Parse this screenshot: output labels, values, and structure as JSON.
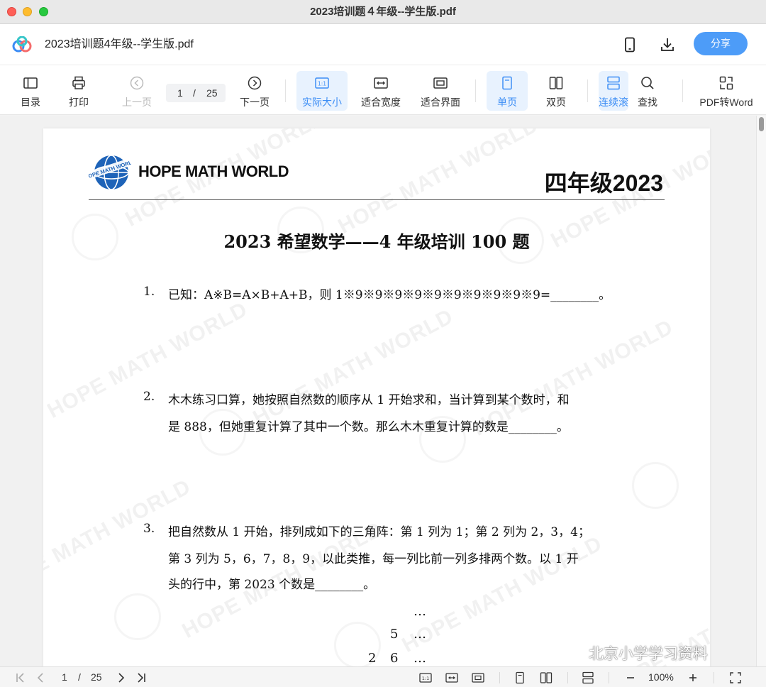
{
  "window": {
    "title": "2023培训题４年级--学生版.pdf"
  },
  "app": {
    "doc_title": "2023培训题4年级--学生版.pdf",
    "share_label": "分享"
  },
  "toolbar": {
    "toc": "目录",
    "print": "打印",
    "prev": "上一页",
    "page_current": "1",
    "page_sep": "/",
    "page_total": "25",
    "next": "下一页",
    "actual_size": "实际大小",
    "fit_width": "适合宽度",
    "fit_page": "适合界面",
    "single": "单页",
    "double": "双页",
    "continuous": "连续滚",
    "search": "查找",
    "pdf_to_word": "PDF转Word"
  },
  "document": {
    "brand": "HOPE MATH WORLD",
    "globe_text": "HOPE MATH WORLD",
    "grade": "四年级2023",
    "heading": "2023 希望数学——4 年级培训 100 题",
    "watermark_text": "HOPE MATH WORLD",
    "questions": [
      {
        "num": "1.",
        "lines": [
          "已知：A※B=A×B+A+B，则 1※9※9※9※9※9※9※9※9※9※9=________。"
        ]
      },
      {
        "num": "2.",
        "lines": [
          "木木练习口算，她按照自然数的顺序从 1 开始求和，当计算到某个数时，和",
          "是 888，但她重复计算了其中一个数。那么木木重复计算的数是________。"
        ]
      },
      {
        "num": "3.",
        "lines": [
          "把自然数从 1 开始，排列成如下的三角阵：第 1 列为 1；第 2 列为 2，3，4；",
          "第 3 列为 5，6，7，8，9，以此类推，每一列比前一列多排两个数。以 1 开",
          "头的行中，第 2023 个数是________。"
        ]
      }
    ],
    "triangle": {
      "dots": "…",
      "r2": "5",
      "r3a": "2",
      "r3b": "6"
    }
  },
  "statusbar": {
    "page_current": "1",
    "page_sep": "/",
    "page_total": "25",
    "zoom": "100%"
  },
  "overlay": {
    "social_watermark": "北京小学学习资料"
  },
  "colors": {
    "accent": "#4d9cf8",
    "active_bg": "#e8f2fe"
  }
}
